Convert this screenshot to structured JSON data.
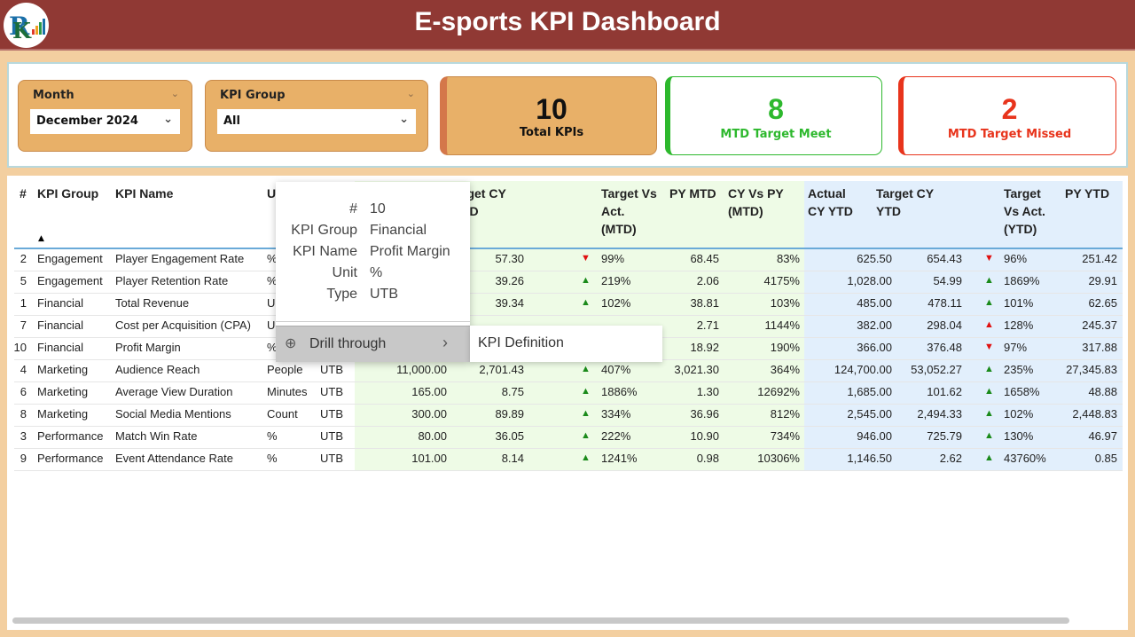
{
  "header": {
    "title": "E-sports KPI Dashboard",
    "logo_text": "PK"
  },
  "filters": {
    "month": {
      "label": "Month",
      "value": "December 2024"
    },
    "kpi_group": {
      "label": "KPI Group",
      "value": "All"
    }
  },
  "cards": [
    {
      "value": "10",
      "label": "Total KPIs"
    },
    {
      "value": "8",
      "label": "MTD Target Meet"
    },
    {
      "value": "2",
      "label": "MTD Target Missed"
    }
  ],
  "colors": {
    "header": "#903934",
    "up": "#1a8a1a",
    "down": "#e01010",
    "meet": "#2db82d",
    "missed": "#e8341c"
  },
  "table": {
    "sort_icon": "sort-ascending-icon",
    "columns": [
      "#",
      "KPI Group",
      "KPI Name",
      "U",
      "rget CY\nTD",
      "Target Vs\nAct.\n(MTD)",
      "PY MTD",
      "CY Vs PY\n(MTD)",
      "Actual\nCY YTD",
      "Target CY\nYTD",
      "Target\nVs Act.\n(YTD)",
      "PY YTD"
    ],
    "rows": [
      {
        "n": "2",
        "group": "Engagement",
        "name": "Player Engagement Rate",
        "unit": "%",
        "type": "",
        "actual_mtd": "",
        "target_mtd": "57.30",
        "mtd_icon": "down-red",
        "tva_mtd": "99%",
        "py_mtd": "68.45",
        "cyvpy": "83%",
        "actual_ytd": "625.50",
        "target_ytd": "654.43",
        "ytd_icon": "down-red",
        "tva_ytd": "96%",
        "py_ytd": "251.42"
      },
      {
        "n": "5",
        "group": "Engagement",
        "name": "Player Retention Rate",
        "unit": "%",
        "type": "",
        "actual_mtd": "",
        "target_mtd": "39.26",
        "mtd_icon": "up-green",
        "tva_mtd": "219%",
        "py_mtd": "2.06",
        "cyvpy": "4175%",
        "actual_ytd": "1,028.00",
        "target_ytd": "54.99",
        "ytd_icon": "up-green",
        "tva_ytd": "1869%",
        "py_ytd": "29.91"
      },
      {
        "n": "1",
        "group": "Financial",
        "name": "Total Revenue",
        "unit": "U",
        "type": "",
        "actual_mtd": "",
        "target_mtd": "39.34",
        "mtd_icon": "up-green",
        "tva_mtd": "102%",
        "py_mtd": "38.81",
        "cyvpy": "103%",
        "actual_ytd": "485.00",
        "target_ytd": "478.11",
        "ytd_icon": "up-green",
        "tva_ytd": "101%",
        "py_ytd": "62.65"
      },
      {
        "n": "7",
        "group": "Financial",
        "name": "Cost per Acquisition (CPA)",
        "unit": "U",
        "type": "",
        "actual_mtd": "",
        "target_mtd": "",
        "mtd_icon": "",
        "tva_mtd": "",
        "py_mtd": "2.71",
        "cyvpy": "1144%",
        "actual_ytd": "382.00",
        "target_ytd": "298.04",
        "ytd_icon": "up-red",
        "tva_ytd": "128%",
        "py_ytd": "245.37"
      },
      {
        "n": "10",
        "group": "Financial",
        "name": "Profit Margin",
        "unit": "%",
        "type": "",
        "actual_mtd": "",
        "target_mtd": "",
        "mtd_icon": "",
        "tva_mtd": "",
        "py_mtd": "18.92",
        "cyvpy": "190%",
        "actual_ytd": "366.00",
        "target_ytd": "376.48",
        "ytd_icon": "down-red",
        "tva_ytd": "97%",
        "py_ytd": "317.88"
      },
      {
        "n": "4",
        "group": "Marketing",
        "name": "Audience Reach",
        "unit": "People",
        "type": "UTB",
        "actual_mtd": "11,000.00",
        "target_mtd": "2,701.43",
        "mtd_icon": "up-green",
        "tva_mtd": "407%",
        "py_mtd": "3,021.30",
        "cyvpy": "364%",
        "actual_ytd": "124,700.00",
        "target_ytd": "53,052.27",
        "ytd_icon": "up-green",
        "tva_ytd": "235%",
        "py_ytd": "27,345.83"
      },
      {
        "n": "6",
        "group": "Marketing",
        "name": "Average View Duration",
        "unit": "Minutes",
        "type": "UTB",
        "actual_mtd": "165.00",
        "target_mtd": "8.75",
        "mtd_icon": "up-green",
        "tva_mtd": "1886%",
        "py_mtd": "1.30",
        "cyvpy": "12692%",
        "actual_ytd": "1,685.00",
        "target_ytd": "101.62",
        "ytd_icon": "up-green",
        "tva_ytd": "1658%",
        "py_ytd": "48.88"
      },
      {
        "n": "8",
        "group": "Marketing",
        "name": "Social Media Mentions",
        "unit": "Count",
        "type": "UTB",
        "actual_mtd": "300.00",
        "target_mtd": "89.89",
        "mtd_icon": "up-green",
        "tva_mtd": "334%",
        "py_mtd": "36.96",
        "cyvpy": "812%",
        "actual_ytd": "2,545.00",
        "target_ytd": "2,494.33",
        "ytd_icon": "up-green",
        "tva_ytd": "102%",
        "py_ytd": "2,448.83"
      },
      {
        "n": "3",
        "group": "Performance",
        "name": "Match Win Rate",
        "unit": "%",
        "type": "UTB",
        "actual_mtd": "80.00",
        "target_mtd": "36.05",
        "mtd_icon": "up-green",
        "tva_mtd": "222%",
        "py_mtd": "10.90",
        "cyvpy": "734%",
        "actual_ytd": "946.00",
        "target_ytd": "725.79",
        "ytd_icon": "up-green",
        "tva_ytd": "130%",
        "py_ytd": "46.97"
      },
      {
        "n": "9",
        "group": "Performance",
        "name": "Event Attendance Rate",
        "unit": "%",
        "type": "UTB",
        "actual_mtd": "101.00",
        "target_mtd": "8.14",
        "mtd_icon": "up-green",
        "tva_mtd": "1241%",
        "py_mtd": "0.98",
        "cyvpy": "10306%",
        "actual_ytd": "1,146.50",
        "target_ytd": "2.62",
        "ytd_icon": "up-green",
        "tva_ytd": "43760%",
        "py_ytd": "0.85"
      }
    ]
  },
  "tooltip": {
    "fields": [
      {
        "k": "#",
        "v": "10"
      },
      {
        "k": "KPI Group",
        "v": "Financial"
      },
      {
        "k": "KPI Name",
        "v": "Profit Margin"
      },
      {
        "k": "Unit",
        "v": "%"
      },
      {
        "k": "Type",
        "v": "UTB"
      }
    ],
    "menu_item": "Drill through",
    "submenu_item": "KPI Definition"
  }
}
